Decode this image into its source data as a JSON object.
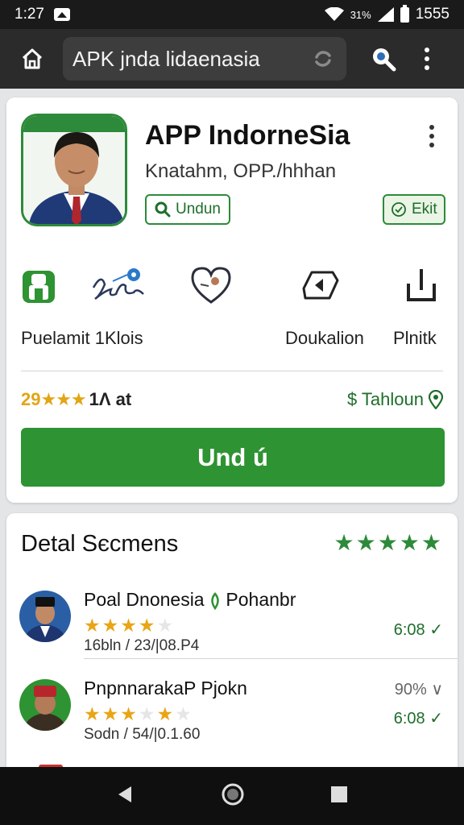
{
  "status_bar": {
    "time": "1:27",
    "battery_percent": "31%",
    "right_value": "1555"
  },
  "browser": {
    "url_text": "APK jnda lidaenasia"
  },
  "app": {
    "title": "APP IndorneSia",
    "developer": "Knatahm, OPP./hhhan",
    "download_chip": "Undun",
    "edit_chip": "Ekit"
  },
  "features": [
    {
      "label": "Puelamit 1Klois",
      "icon": "robot-icon"
    },
    {
      "label": "",
      "icon": "handwriting-icon"
    },
    {
      "label": "",
      "icon": "heart-icon"
    },
    {
      "label": "Doukalion",
      "icon": "share-icon"
    },
    {
      "label": "Plnitk",
      "icon": "download-icon"
    }
  ],
  "rating": {
    "value": "29",
    "stars": "★★★",
    "count": "1Λ at"
  },
  "tahlun": "$ Tahloun",
  "install_button": "Und ú",
  "detail": {
    "title": "Detal Sєcmens",
    "stars": "★★★★★",
    "reviews": [
      {
        "name": "Poal Dnonesia",
        "name_suffix": "Pohanbr",
        "stars_on": 4,
        "date": "16bln / 23/|08.P4",
        "right_text": "",
        "time": "6:08"
      },
      {
        "name": "PnpnnarakaP Pjokn",
        "name_suffix": "",
        "stars_on": 3,
        "date": "Sodn / 54/|0.1.60",
        "right_text": "90%",
        "time": "6:08"
      }
    ]
  },
  "colors": {
    "brand_green": "#2e9332",
    "star_gold": "#e2a515",
    "top_bar": "#2b2b2b"
  }
}
